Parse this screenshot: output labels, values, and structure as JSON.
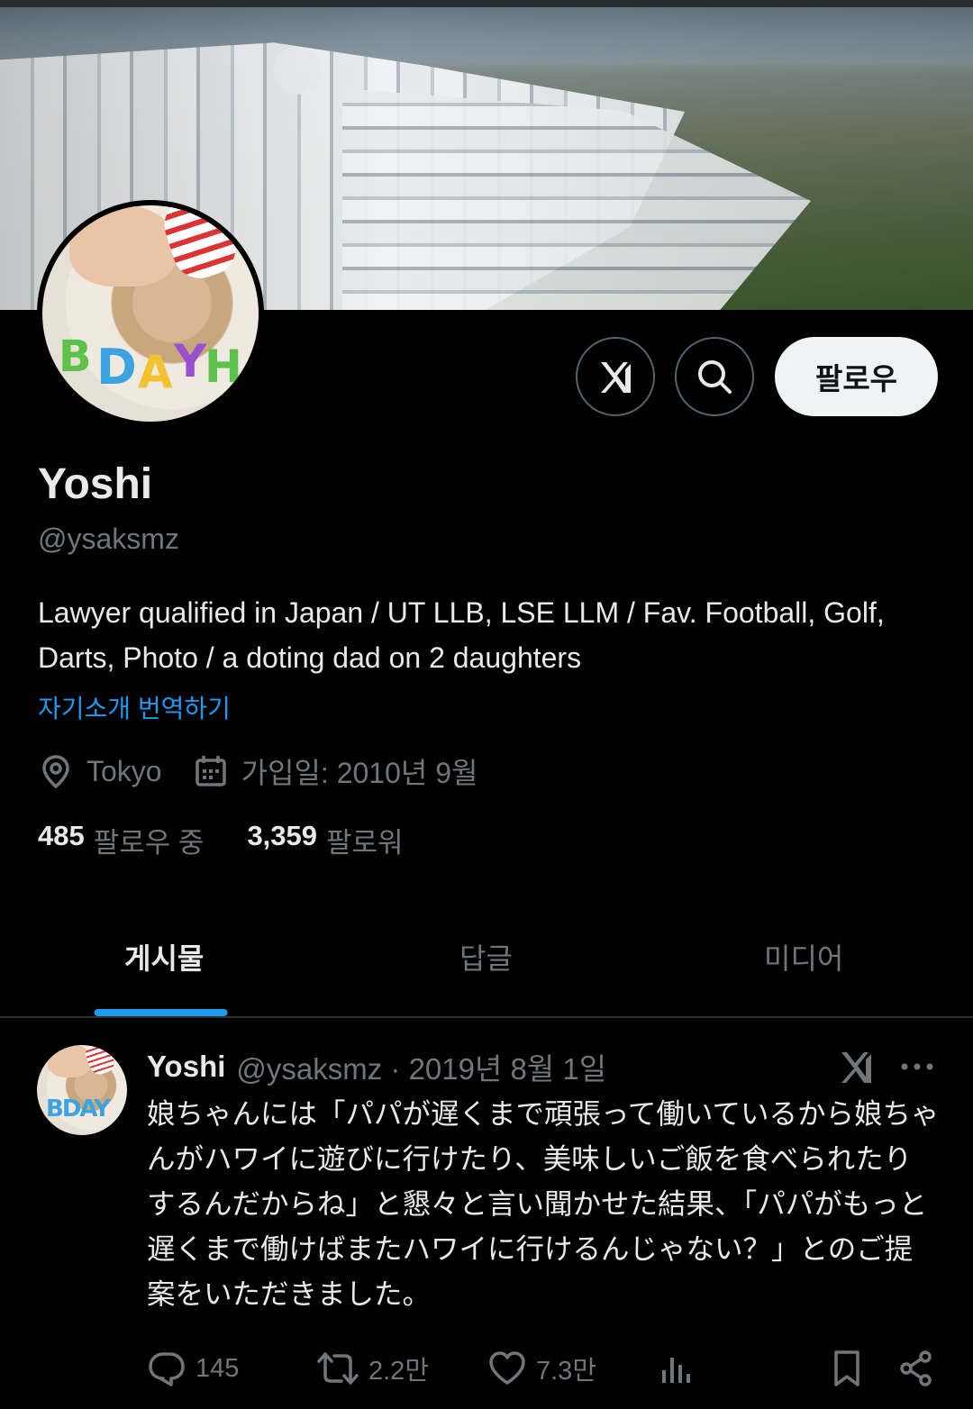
{
  "profile": {
    "name": "Yoshi",
    "handle": "@ysaksmz",
    "bio": "Lawyer qualified in Japan / UT LLB, LSE LLM / Fav. Football, Golf, Darts, Photo / a doting dad on 2 daughters",
    "translate_label": "자기소개 번역하기",
    "location": "Tokyo",
    "joined": "가입일: 2010년 9월",
    "following_count": "485",
    "following_label": "팔로우 중",
    "followers_count": "3,359",
    "followers_label": "팔로워",
    "follow_button": "팔로우",
    "avatar_candles": "BDAY"
  },
  "tabs": [
    {
      "label": "게시물",
      "active": true
    },
    {
      "label": "답글",
      "active": false
    },
    {
      "label": "미디어",
      "active": false
    }
  ],
  "post": {
    "name": "Yoshi",
    "handle_date": "@ysaksmz · 2019년 8월 1일",
    "text": "娘ちゃんには「パパが遅くまで頑張って働いているから娘ちゃんがハワイに遊びに行けたり、美味しいご飯を食べられたりするんだからね」と懇々と言い聞かせた結果、「パパがもっと遅くまで働けばまたハワイに行けるんじゃない？」とのご提案をいただきました。",
    "replies": "145",
    "reposts": "2.2만",
    "likes": "7.3만"
  },
  "colors": {
    "accent": "#1d9bf0",
    "muted": "#71767b",
    "text": "#e7e9ea",
    "background": "#000000"
  },
  "icons": [
    "grok-icon",
    "search-icon",
    "location-icon",
    "calendar-icon",
    "more-icon",
    "reply-icon",
    "repost-icon",
    "like-icon",
    "views-icon",
    "bookmark-icon",
    "share-icon"
  ]
}
